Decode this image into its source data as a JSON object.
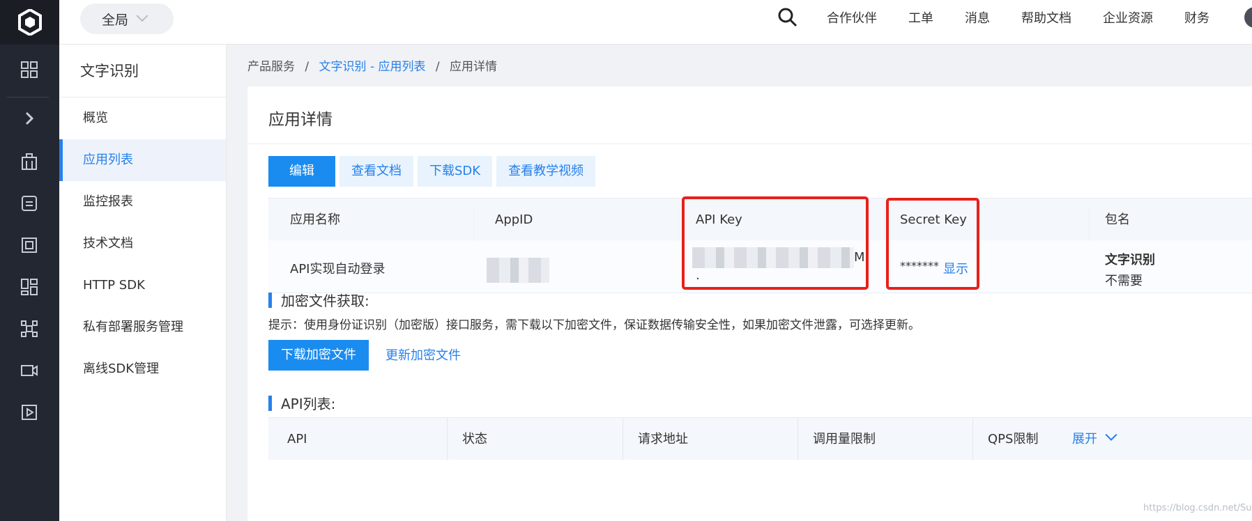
{
  "topbar": {
    "scope_label": "全局",
    "nav": [
      "合作伙伴",
      "工单",
      "消息",
      "帮助文档",
      "企业资源",
      "财务"
    ]
  },
  "rail": {
    "icons": [
      "grid-icon",
      "expand-chevron-icon",
      "building-icon",
      "database-icon",
      "chip-icon",
      "dashboard-icon",
      "network-icon",
      "video-icon",
      "play-icon"
    ]
  },
  "sidebar": {
    "title": "文字识别",
    "items": [
      {
        "label": "概览",
        "active": false
      },
      {
        "label": "应用列表",
        "active": true
      },
      {
        "label": "监控报表",
        "active": false
      },
      {
        "label": "技术文档",
        "active": false
      },
      {
        "label": "HTTP SDK",
        "active": false
      },
      {
        "label": "私有部署服务管理",
        "active": false
      },
      {
        "label": "离线SDK管理",
        "active": false
      }
    ]
  },
  "breadcrumb": {
    "root": "产品服务",
    "link": "文字识别 - 应用列表",
    "current": "应用详情",
    "separator": "/"
  },
  "main": {
    "title": "应用详情",
    "actions": [
      "编辑",
      "查看文档",
      "下载SDK",
      "查看教学视频"
    ],
    "app_table": {
      "headers": [
        "应用名称",
        "AppID",
        "API Key",
        "Secret Key",
        "包名"
      ],
      "row": {
        "app_name": "API实现自动登录",
        "api_key_tail": "M",
        "api_key_dot": ".",
        "secret_mask": "*******",
        "secret_show": "显示",
        "package_title": "文字识别",
        "package_value": "不需要"
      }
    },
    "encrypt_section": {
      "title": "加密文件获取:",
      "tip": "提示：使用身份证识别（加密版）接口服务，需下载以下加密文件，保证数据传输安全性，如果加密文件泄露，可选择更新。",
      "download_label": "下载加密文件",
      "update_label": "更新加密文件"
    },
    "api_section": {
      "title": "API列表:",
      "headers": [
        "API",
        "状态",
        "请求地址",
        "调用量限制",
        "QPS限制"
      ],
      "expand_label": "展开"
    }
  },
  "watermark": "https://blog.csdn.net/Sub_xu",
  "colors": {
    "accent": "#2680eb",
    "primary_button": "#1a8cf0",
    "highlight_red": "#e8201a",
    "rail_bg": "#232731"
  }
}
